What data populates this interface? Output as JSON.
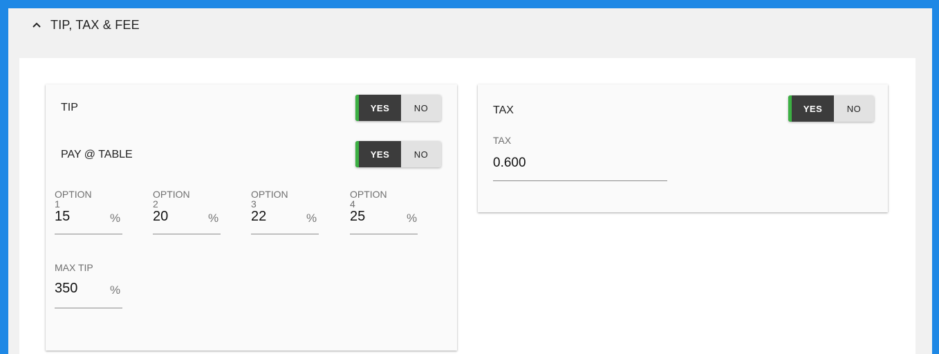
{
  "section": {
    "title": "TIP, TAX & FEE",
    "chevron_icon": "chevron-up-icon"
  },
  "tip_card": {
    "tip_label": "TIP",
    "tip_toggle": {
      "yes": "YES",
      "no": "NO",
      "selected": "YES"
    },
    "pay_label": "PAY @ TABLE",
    "pay_toggle": {
      "yes": "YES",
      "no": "NO",
      "selected": "YES"
    },
    "options": [
      {
        "label": "OPTION",
        "number": "1",
        "value": "15",
        "unit": "%"
      },
      {
        "label": "OPTION",
        "number": "2",
        "value": "20",
        "unit": "%"
      },
      {
        "label": "OPTION",
        "number": "3",
        "value": "22",
        "unit": "%"
      },
      {
        "label": "OPTION",
        "number": "4",
        "value": "25",
        "unit": "%"
      }
    ],
    "max_tip": {
      "label": "MAX TIP",
      "value": "350",
      "unit": "%"
    }
  },
  "tax_card": {
    "tax_label": "TAX",
    "tax_toggle": {
      "yes": "YES",
      "no": "NO",
      "selected": "YES"
    },
    "tax_field": {
      "label": "TAX",
      "value": "0.600"
    }
  },
  "colors": {
    "frame": "#1e88e5",
    "toggle_on": "#3c3c3c",
    "toggle_off": "#e2e2e2",
    "toggle_accent": "#3cb043"
  }
}
